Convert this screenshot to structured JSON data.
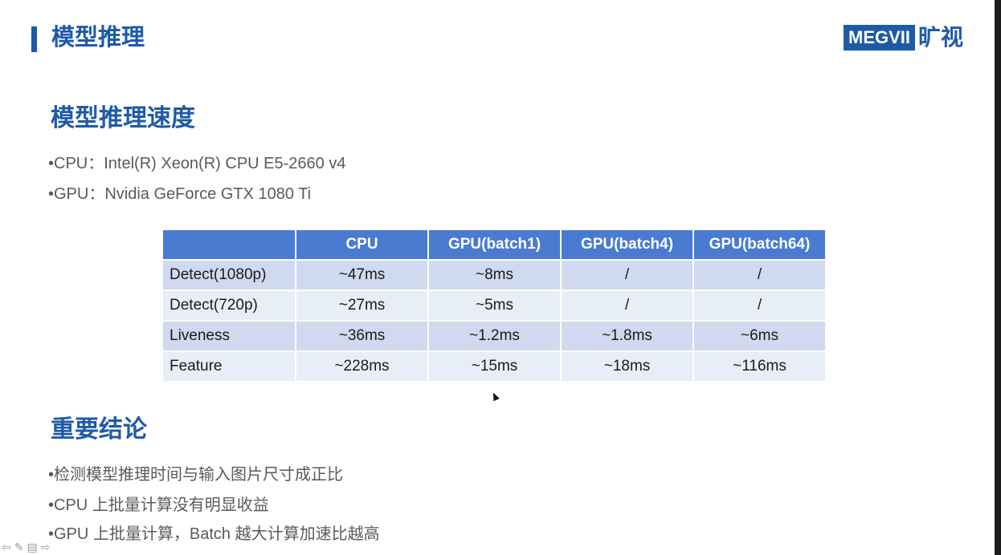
{
  "header": {
    "title": "模型推理",
    "logo_text": "MEGVII",
    "logo_cn": "旷视"
  },
  "section1": {
    "heading": "模型推理速度",
    "bullets": [
      "•CPU：Intel(R) Xeon(R) CPU E5-2660 v4",
      "•GPU：Nvidia GeForce GTX 1080 Ti"
    ]
  },
  "table": {
    "columns": [
      "",
      "CPU",
      "GPU(batch1)",
      "GPU(batch4)",
      "GPU(batch64)"
    ],
    "rows": [
      [
        "Detect(1080p)",
        "~47ms",
        "~8ms",
        "/",
        "/"
      ],
      [
        "Detect(720p)",
        "~27ms",
        "~5ms",
        "/",
        "/"
      ],
      [
        "Liveness",
        "~36ms",
        "~1.2ms",
        "~1.8ms",
        "~6ms"
      ],
      [
        "Feature",
        "~228ms",
        "~15ms",
        "~18ms",
        "~116ms"
      ]
    ]
  },
  "section2": {
    "heading": "重要结论",
    "bullets": [
      "•检测模型推理时间与输入图片尺寸成正比",
      "•CPU 上批量计算没有明显收益",
      "•GPU 上批量计算，Batch 越大计算加速比越高"
    ]
  },
  "nav": {
    "prev": "⇦",
    "pen": "✎",
    "menu": "▤",
    "next": "⇨"
  },
  "colors": {
    "accent": "#1f5aa8",
    "table_header": "#4a7bd0",
    "row_dark": "#cfdaf0",
    "row_light": "#e8eef8"
  }
}
